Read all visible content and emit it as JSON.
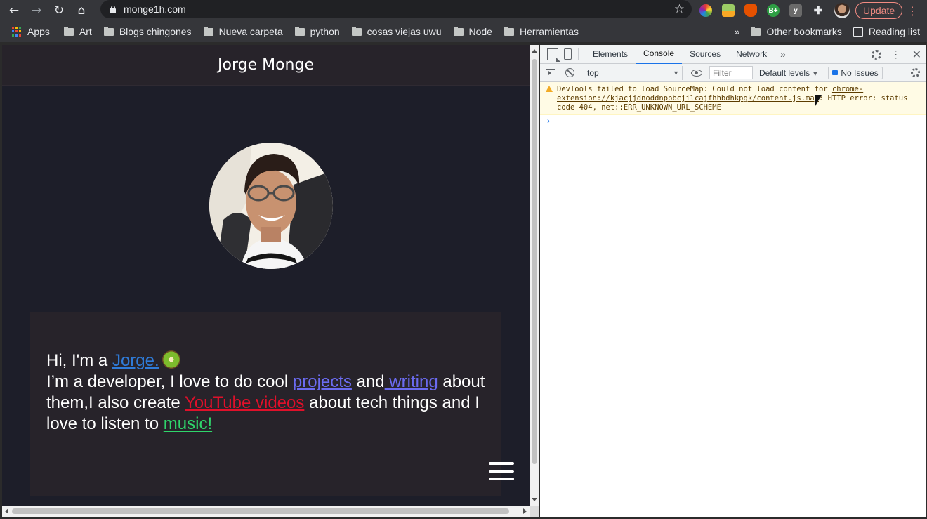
{
  "browser": {
    "url": "monge1h.com",
    "update_label": "Update",
    "bookmarks": [
      "Apps",
      "Art",
      "Blogs chingones",
      "Nueva carpeta",
      "python",
      "cosas viejas uwu",
      "Node",
      "Herramientas"
    ],
    "other_bookmarks": "Other bookmarks",
    "reading_list": "Reading list",
    "extension_labels": {
      "bplus": "B+",
      "y": "y"
    }
  },
  "site": {
    "header_title": "Jorge Monge",
    "intro": {
      "prefix": "Hi, I'm a ",
      "name_link": "Jorge.",
      "line2_prefix": "I’m a developer, I love to do cool ",
      "projects_link": "projects",
      "and": " and",
      "writing_link": " writing",
      "line3": " about them,I also create ",
      "youtube_link": "YouTube videos",
      "line3_suffix": " about tech things and I love to listen to ",
      "music_link": "music!"
    }
  },
  "devtools": {
    "tabs": [
      "Elements",
      "Console",
      "Sources",
      "Network"
    ],
    "active_tab": "Console",
    "context": "top",
    "filter_placeholder": "Filter",
    "levels": "Default levels",
    "issues": "No Issues",
    "warning": {
      "text_before": "DevTools failed to load SourceMap: Could not load content for ",
      "link": "chrome-extension://kjacjjdnoddnpbbcjilcajfhhbdhkpgk/content.js.map",
      "text_after": ": HTTP error: status code 404, net::ERR_UNKNOWN_URL_SCHEME"
    },
    "prompt": "›"
  },
  "colors": {
    "page_bg": "#1d1e29",
    "header_bg": "#27232a",
    "link_name": "#2f7bd8",
    "link_projects": "#6b6bf0",
    "link_youtube": "#e0102a",
    "link_music": "#2fd66b",
    "devtools_accent": "#1a73e8"
  }
}
